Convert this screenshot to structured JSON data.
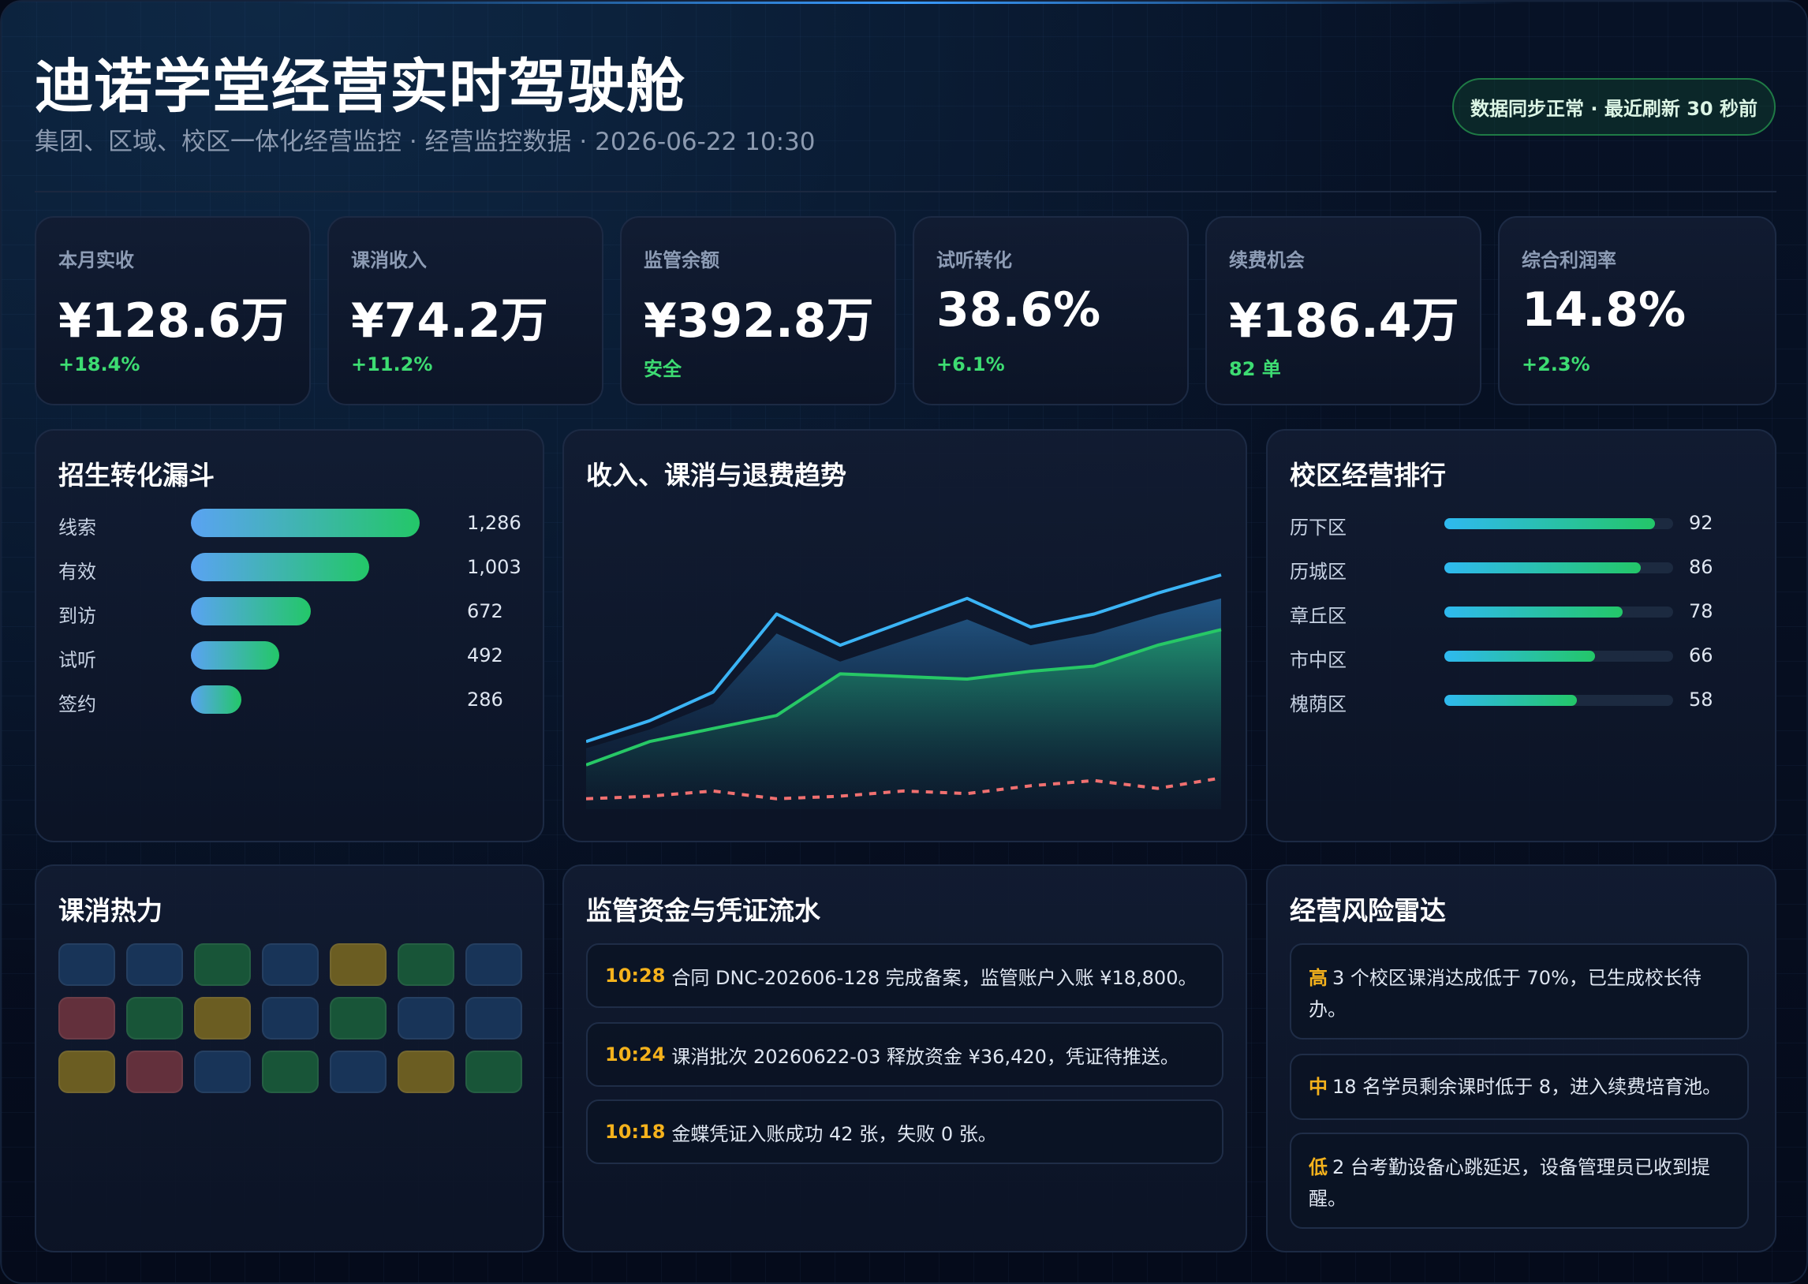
{
  "header": {
    "title": "迪诺学堂经营实时驾驶舱",
    "subtitle": "集团、区域、校区一体化经营监控 · 经营监控数据 · 2026-06-22 10:30",
    "sync_status": "数据同步正常 · 最近刷新 30 秒前"
  },
  "kpis": [
    {
      "label": "本月实收",
      "value": "¥128.6万",
      "delta": "+18.4%"
    },
    {
      "label": "课消收入",
      "value": "¥74.2万",
      "delta": "+11.2%"
    },
    {
      "label": "监管余额",
      "value": "¥392.8万",
      "delta": "安全"
    },
    {
      "label": "试听转化",
      "value": "38.6%",
      "delta": "+6.1%"
    },
    {
      "label": "续费机会",
      "value": "¥186.4万",
      "delta": "82 单"
    },
    {
      "label": "综合利润率",
      "value": "14.8%",
      "delta": "+2.3%"
    }
  ],
  "funnel": {
    "title": "招生转化漏斗",
    "rows": [
      {
        "label": "线索",
        "value": "1,286",
        "ratio": 1.0
      },
      {
        "label": "有效",
        "value": "1,003",
        "ratio": 0.78
      },
      {
        "label": "到访",
        "value": "672",
        "ratio": 0.525
      },
      {
        "label": "试听",
        "value": "492",
        "ratio": 0.385
      },
      {
        "label": "签约",
        "value": "286",
        "ratio": 0.22
      }
    ]
  },
  "trend": {
    "title": "收入、课消与退费趋势"
  },
  "chart_data": {
    "type": "line",
    "title": "收入、课消与退费趋势",
    "x": [
      0,
      1,
      2,
      3,
      4,
      5,
      6,
      7,
      8,
      9,
      10
    ],
    "ylim": [
      0,
      100
    ],
    "series": [
      {
        "values": [
          26,
          34,
          45,
          75,
          63,
          72,
          81,
          70,
          75,
          83,
          90
        ]
      },
      {
        "values": [
          17,
          26,
          31,
          36,
          52,
          51,
          50,
          53,
          55,
          63,
          69
        ]
      },
      {
        "values": [
          4,
          5,
          7,
          4,
          5,
          7,
          6,
          9,
          11,
          8,
          12
        ]
      }
    ],
    "colors": [
      "#3bb4f5",
      "#27c866",
      "#f07070"
    ]
  },
  "ranking": {
    "title": "校区经营排行",
    "rows": [
      {
        "label": "历下区",
        "value": "92",
        "ratio": 0.92
      },
      {
        "label": "历城区",
        "value": "86",
        "ratio": 0.86
      },
      {
        "label": "章丘区",
        "value": "78",
        "ratio": 0.78
      },
      {
        "label": "市中区",
        "value": "66",
        "ratio": 0.66
      },
      {
        "label": "槐荫区",
        "value": "58",
        "ratio": 0.58
      }
    ]
  },
  "heatmap": {
    "title": "课消热力",
    "cells": [
      [
        "blue",
        "blue",
        "green",
        "blue",
        "yellow",
        "green",
        "blue"
      ],
      [
        "red",
        "green",
        "yellow",
        "blue",
        "green",
        "blue",
        "blue"
      ],
      [
        "yellow",
        "red",
        "blue",
        "green",
        "blue",
        "yellow",
        "green"
      ]
    ],
    "palette": {
      "blue": "#183458",
      "green": "#185538",
      "yellow": "#6b5d22",
      "red": "#63303c"
    }
  },
  "funds": {
    "title": "监管资金与凭证流水",
    "items": [
      {
        "time": "10:28",
        "text": "合同 DNC-202606-128 完成备案，监管账户入账 ¥18,800。"
      },
      {
        "time": "10:24",
        "text": "课消批次 20260622-03 释放资金 ¥36,420，凭证待推送。"
      },
      {
        "time": "10:18",
        "text": "金蝶凭证入账成功 42 张，失败 0 张。"
      }
    ]
  },
  "risk": {
    "title": "经营风险雷达",
    "items": [
      {
        "level": "高",
        "text": "3 个校区课消达成低于 70%，已生成校长待办。",
        "color": "#f5b21c"
      },
      {
        "level": "中",
        "text": "18 名学员剩余课时低于 8，进入续费培育池。",
        "color": "#f5b21c"
      },
      {
        "level": "低",
        "text": "2 台考勤设备心跳延迟，设备管理员已收到提醒。",
        "color": "#f5b21c"
      }
    ]
  }
}
